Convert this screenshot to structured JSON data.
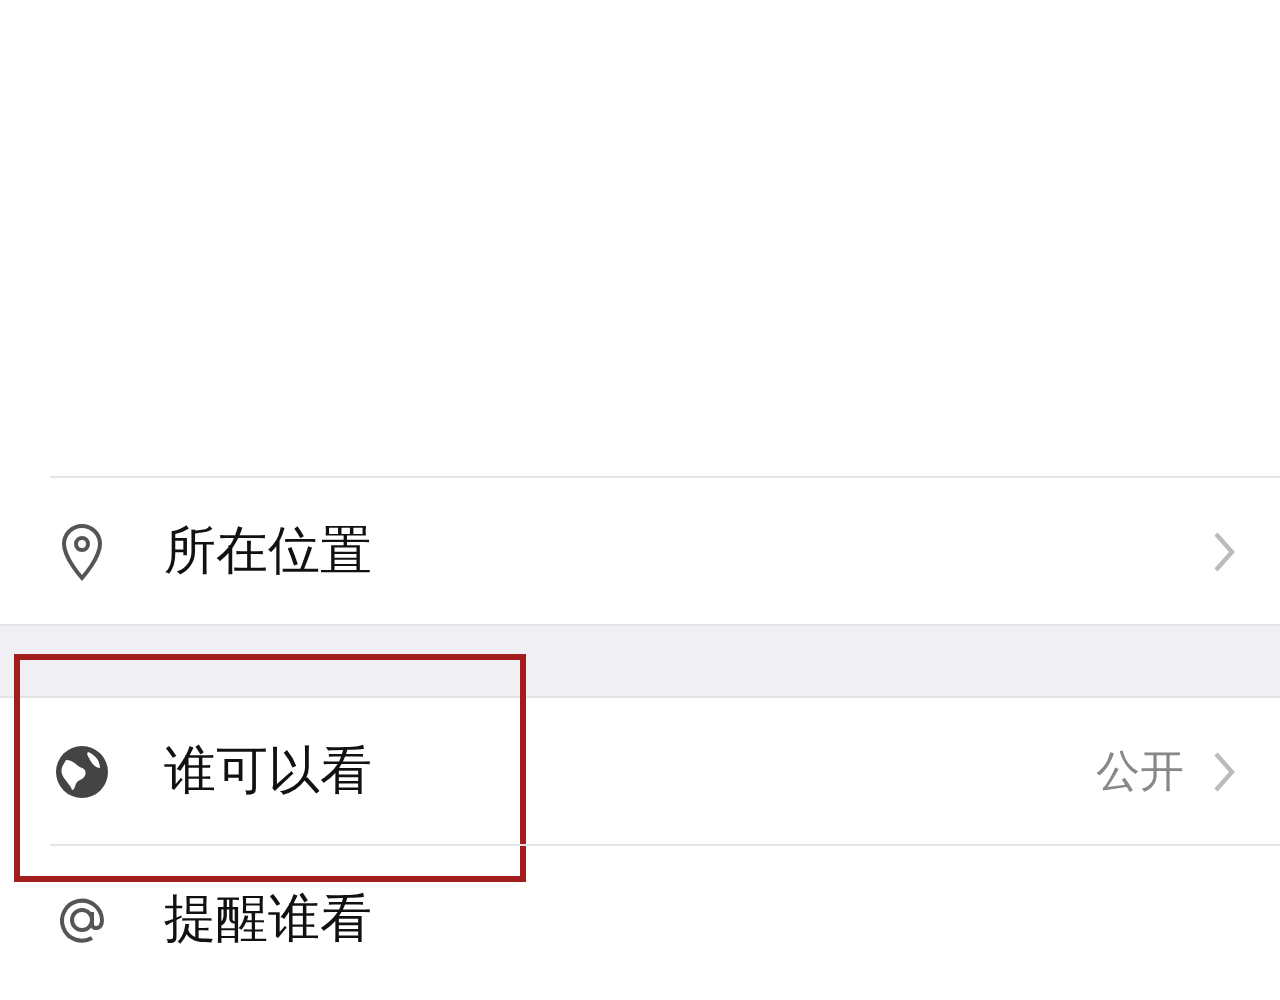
{
  "groups": [
    {
      "items": [
        {
          "kind": "location",
          "label": "所在位置"
        }
      ]
    },
    {
      "items": [
        {
          "kind": "visibility",
          "label": "谁可以看",
          "value": "公开",
          "highlighted": true
        },
        {
          "kind": "mention",
          "label": "提醒谁看"
        }
      ]
    }
  ]
}
